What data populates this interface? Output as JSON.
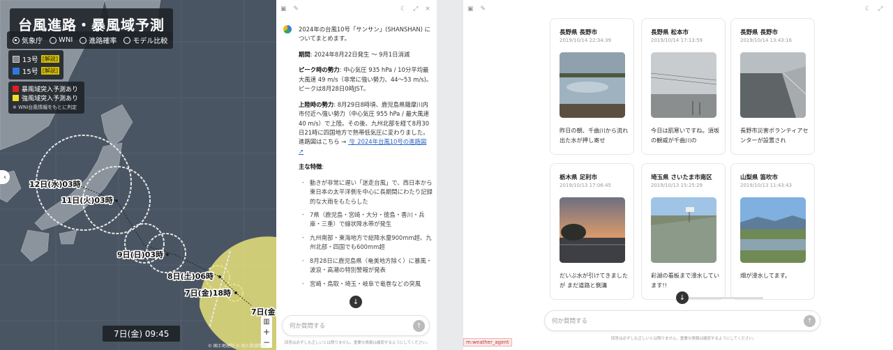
{
  "map": {
    "title": "台風進路・暴風域予測",
    "sources": [
      "気象庁",
      "WNI",
      "進路確率",
      "モデル比較"
    ],
    "selected_source": "気象庁",
    "storms": [
      {
        "label": "13号",
        "tag": "[解説]",
        "checked": false
      },
      {
        "label": "15号",
        "tag": "[解説]",
        "checked": true
      }
    ],
    "legend": [
      {
        "label": "暴風域突入予測あり",
        "color": "#e02020"
      },
      {
        "label": "強風域突入予測あり",
        "color": "#f0e020"
      }
    ],
    "legend_note": "※ WNI台風情報をもとに判定",
    "forecast_labels": [
      "12日(水)03時",
      "11日(火)03時",
      "9日(日)03時",
      "8日(土)06時",
      "7日(金)18時",
      "7日(金"
    ],
    "time": "7日(金) 09:45",
    "zoom_in": "+",
    "zoom_out": "−",
    "attribution": "© 国土地理院 © 国土数値情報",
    "side_arrow": "‹",
    "layer_icon": "▥"
  },
  "chat": {
    "paragraphs": {
      "intro": "2024年の台風10号「サンサン」(SHANSHAN) についてまとめます。",
      "period_label": "期間",
      "period": ": 2024年8月22日発生 〜 9月1日消滅",
      "peak_label": "ピーク時の勢力",
      "peak": ": 中心気圧 935 hPa / 10分平均最大風速 49 m/s（非常に強い勢力、44〜53 m/s)。ピークは8月28日0時JST。",
      "landfall_label": "上陸時の勢力",
      "landfall": ": 8月29日8時頃、鹿児島県薩摩川内市付近へ強い勢力（中心気圧 955 hPa / 最大風速 40 m/s）で上陸。その後、九州北部を経て8月30日21時に四国地方で熱帯低気圧に変わりました。進路図はこちら → ",
      "link": "🌪 2024年台風10号の進路図 ↗",
      "features_label": "主な特徴",
      "features_colon": ":"
    },
    "features": [
      "動きが非常に遅い「迷走台風」で、西日本から東日本の太平洋側を中心に長期間にわたり記録的な大雨をもたらした",
      "7県（鹿児島・宮崎・大分・徳島・香川・兵庫・三重）で線状降水帯が発生",
      "九州南部・東海地方で総降水量900mm超、九州北部・四国でも600mm超",
      "8月28日に鹿児島県（奄美地方除く）に暴風・波浪・高潮の特別警報が発表",
      "宮崎・鳥取・埼玉・岐阜で竜巻などの突風"
    ],
    "input_placeholder": "何か質問する",
    "disclaimer": "回答は必ずしも正しいとは限りません。重要な情報は確認するようにしてください。"
  },
  "photos": {
    "cards": [
      {
        "loc": "長野県 長野市",
        "time": "2019/10/14 22:34:39",
        "text": "昨日の朝、千曲川から流れ出た水が押し寄せ"
      },
      {
        "loc": "長野県 松本市",
        "time": "2019/10/14 17:13:59",
        "text": "今日は肌寒いですね。須坂の観威が千曲川の"
      },
      {
        "loc": "長野県 長野市",
        "time": "2019/10/14 13:43:16",
        "text": "長野市災害ボランティアセンターが設置され"
      },
      {
        "loc": "栃木県 足利市",
        "time": "2019/10/13 17:06:45",
        "text": "だいぶ水が引けてきましたが まだ道路と側溝"
      },
      {
        "loc": "埼玉県 さいたま市南区",
        "time": "2019/10/13 15:25:29",
        "text": "彩湖の看板まで浸水しています!!"
      },
      {
        "loc": "山梨県 笛吹市",
        "time": "2019/10/13 11:43:43",
        "text": "畑が浸水してます。"
      }
    ],
    "input_placeholder": "何か質問する",
    "disclaimer": "回答は必ずしも正しいとは限りません。重要な情報は確認するようにしてください。",
    "agent_tag": "m:weather_agent"
  },
  "icons": {
    "sidebar": "▣",
    "edit": "✎",
    "moon": "☾",
    "expand": "⤢",
    "close": "×",
    "scroll_down": "↓",
    "send": "↑"
  }
}
